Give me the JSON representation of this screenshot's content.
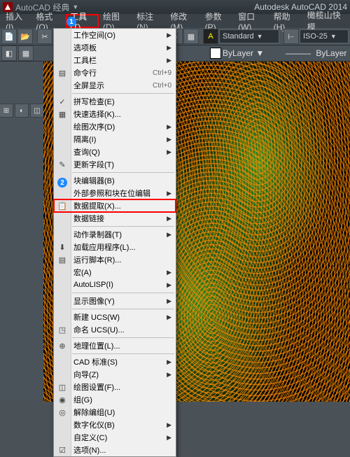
{
  "title_bar": {
    "workspace": "AutoCAD 经典",
    "app_name": "Autodesk AutoCAD 2014"
  },
  "menu_bar": {
    "items": [
      "插入(I)",
      "格式(O)",
      "工具(T)",
      "绘图(D)",
      "标注(N)",
      "修改(M)",
      "参数(P)",
      "窗口(W)",
      "帮助(H)",
      "橄榄山快模"
    ]
  },
  "annotations": {
    "one": "1",
    "two": "2"
  },
  "toolbar1": {
    "standard": "Standard",
    "iso": "ISO-25"
  },
  "toolbar2": {
    "bylayer1": "ByLayer",
    "bylayer2": "ByLayer"
  },
  "dropdown": {
    "groups": [
      [
        {
          "label": "工作空间(O)",
          "icon": "",
          "sub": true
        },
        {
          "label": "选项板",
          "icon": "",
          "sub": true
        },
        {
          "label": "工具栏",
          "icon": "",
          "sub": true
        },
        {
          "label": "命令行",
          "icon": "▤",
          "shortcut": "Ctrl+9"
        },
        {
          "label": "全屏显示",
          "icon": "",
          "shortcut": "Ctrl+0"
        }
      ],
      [
        {
          "label": "拼写检查(E)",
          "icon": "✓"
        },
        {
          "label": "快速选择(K)...",
          "icon": "▦"
        },
        {
          "label": "绘图次序(D)",
          "icon": "",
          "sub": true
        },
        {
          "label": "隔离(I)",
          "icon": "",
          "sub": true
        },
        {
          "label": "查询(Q)",
          "icon": "",
          "sub": true
        },
        {
          "label": "更新字段(T)",
          "icon": "✎"
        }
      ],
      [
        {
          "label": "块编辑器(B)",
          "icon": "◫"
        },
        {
          "label": "外部参照和块在位编辑",
          "icon": "",
          "sub": true
        },
        {
          "label": "数据提取(X)...",
          "icon": "📋",
          "highlight": true
        },
        {
          "label": "数据链接",
          "icon": "",
          "sub": true
        }
      ],
      [
        {
          "label": "动作录制器(T)",
          "icon": "",
          "sub": true
        },
        {
          "label": "加载应用程序(L)...",
          "icon": "⬇"
        },
        {
          "label": "运行脚本(R)...",
          "icon": "▤"
        },
        {
          "label": "宏(A)",
          "icon": "",
          "sub": true
        },
        {
          "label": "AutoLISP(I)",
          "icon": "",
          "sub": true
        }
      ],
      [
        {
          "label": "显示图像(Y)",
          "icon": "",
          "sub": true
        }
      ],
      [
        {
          "label": "新建 UCS(W)",
          "icon": "",
          "sub": true
        },
        {
          "label": "命名 UCS(U)...",
          "icon": "◳"
        }
      ],
      [
        {
          "label": "地理位置(L)...",
          "icon": "⊕"
        }
      ],
      [
        {
          "label": "CAD 标准(S)",
          "icon": "",
          "sub": true
        },
        {
          "label": "向导(Z)",
          "icon": "",
          "sub": true
        },
        {
          "label": "绘图设置(F)...",
          "icon": "◫"
        },
        {
          "label": "组(G)",
          "icon": "◉"
        },
        {
          "label": "解除编组(U)",
          "icon": "◎"
        },
        {
          "label": "数字化仪(B)",
          "icon": "",
          "sub": true
        },
        {
          "label": "自定义(C)",
          "icon": "",
          "sub": true
        },
        {
          "label": "选项(N)...",
          "icon": "☑"
        }
      ]
    ]
  }
}
